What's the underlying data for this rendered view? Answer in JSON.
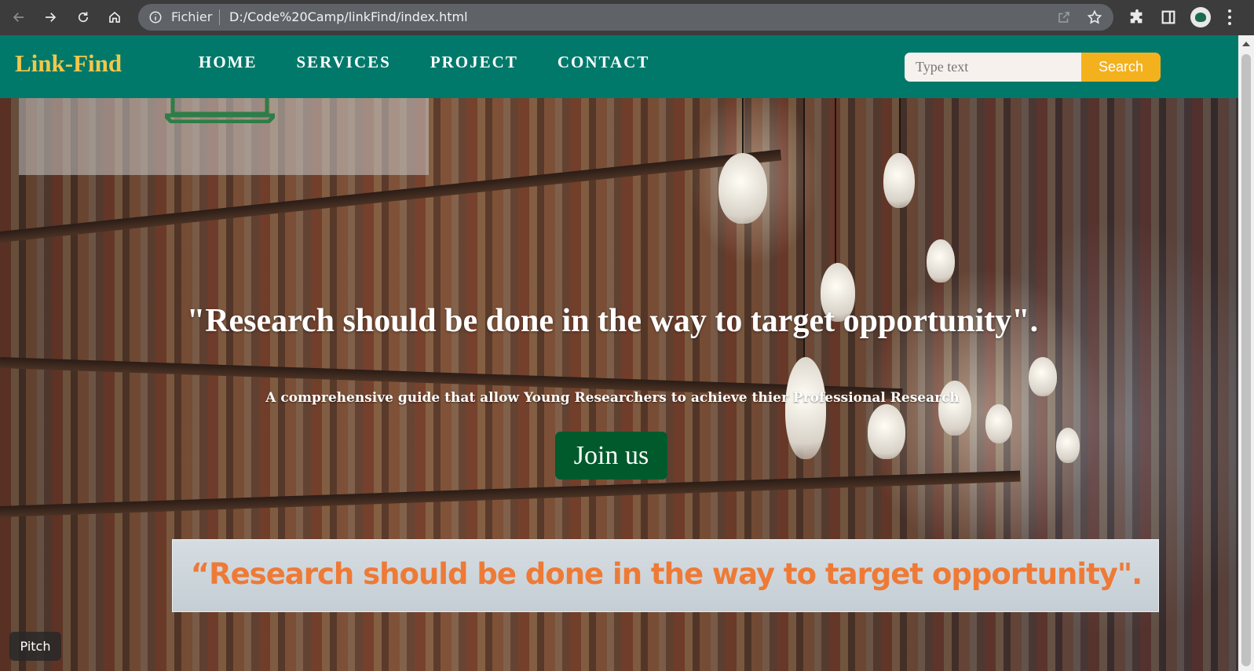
{
  "browser": {
    "scheme_label": "Fichier",
    "url": "D:/Code%20Camp/linkFind/index.html",
    "icons": [
      "back-arrow-icon",
      "forward-arrow-icon",
      "reload-icon",
      "home-icon",
      "info-icon",
      "share-icon",
      "star-icon",
      "extensions-icon",
      "side-panel-icon",
      "profile-avatar",
      "more-menu-icon"
    ]
  },
  "site": {
    "brand": "Link-Find",
    "nav": [
      "HOME",
      "SERVICES",
      "PROJECT",
      "CONTACT"
    ],
    "search_placeholder": "Type text",
    "search_button": "Search",
    "logo_left": "Link",
    "logo_right": "Find"
  },
  "hero": {
    "headline": "\"Research should be done in the way to target opportunity\".",
    "subline": "A comprehensive guide that allow Young Researchers to achieve thier Professional Research",
    "cta": "Join us",
    "banner": "“Research should be done in the way to target opportunity\"."
  },
  "overlay": {
    "pitch_label": "Pitch"
  },
  "colors": {
    "navbar": "#00796b",
    "brand": "#f1c84b",
    "search_button": "#f4b11e",
    "cta": "#005a2b",
    "banner_text": "#ee7a36"
  }
}
